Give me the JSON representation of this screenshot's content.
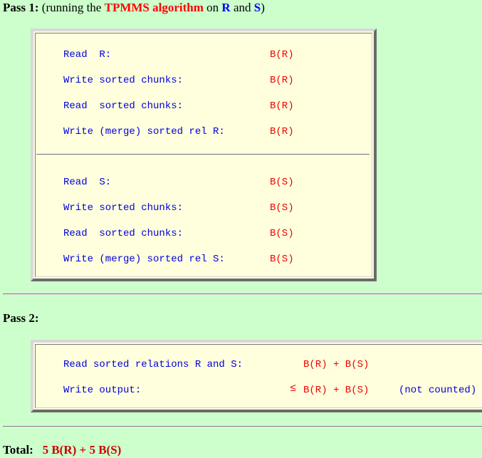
{
  "pass1": {
    "label": "Pass 1:",
    "desc_prefix": "(running the",
    "algo": "TPMMS algorithm",
    "on": "on",
    "r": "R",
    "and": "and",
    "s": "S",
    "close": ")",
    "block_r": [
      {
        "label": "Read  R:",
        "value": "B(R)"
      },
      {
        "label": "Write sorted chunks:",
        "value": "B(R)"
      },
      {
        "label": "Read  sorted chunks:",
        "value": "B(R)"
      },
      {
        "label": "Write (merge) sorted rel R:",
        "value": "B(R)"
      }
    ],
    "block_s": [
      {
        "label": "Read  S:",
        "value": "B(S)"
      },
      {
        "label": "Write sorted chunks:",
        "value": "B(S)"
      },
      {
        "label": "Read  sorted chunks:",
        "value": "B(S)"
      },
      {
        "label": "Write (merge) sorted rel S:",
        "value": "B(S)"
      }
    ]
  },
  "pass2": {
    "label": "Pass 2:",
    "rows": [
      {
        "label": "Read sorted relations R and S:",
        "prefix": "",
        "value": "B(R) + B(S)",
        "note": ""
      },
      {
        "label": "Write output:",
        "prefix": "≤",
        "value": "B(R) + B(S)",
        "note": "(not counted)"
      }
    ]
  },
  "total": {
    "label": "Total:",
    "value": "5 B(R) + 5 B(S)"
  }
}
